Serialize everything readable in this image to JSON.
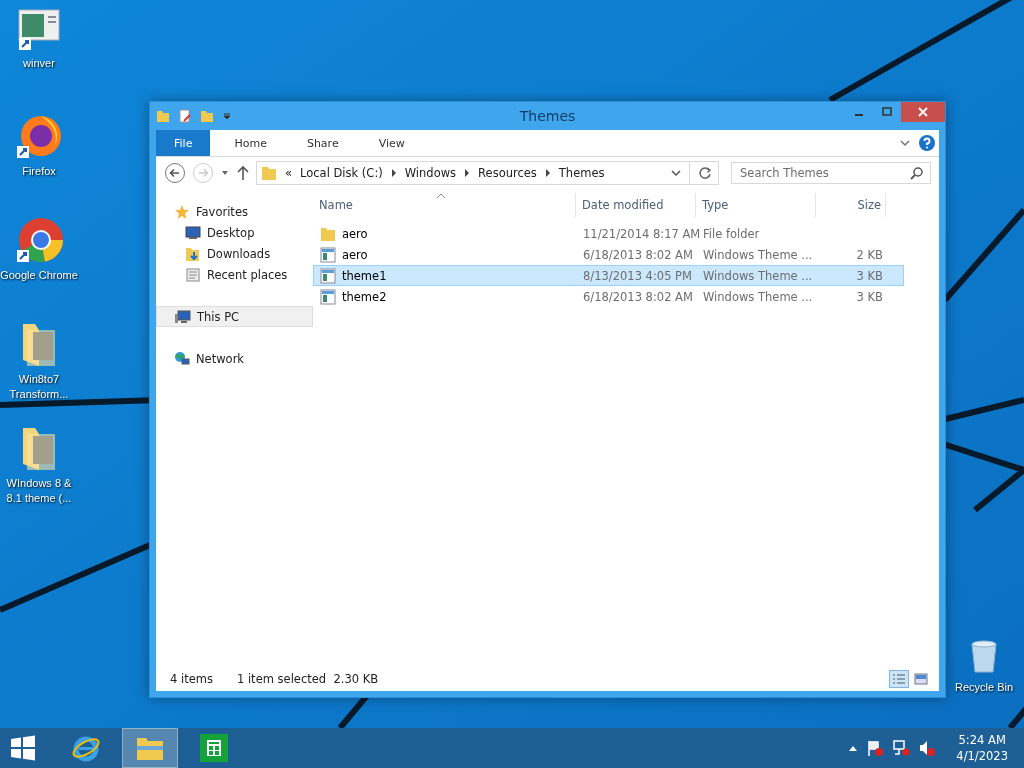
{
  "desktop_icons": [
    {
      "label": "winver",
      "kind": "window"
    },
    {
      "label": "Firefox",
      "kind": "firefox"
    },
    {
      "label": "Google Chrome",
      "kind": "chrome"
    },
    {
      "label": "Win8to7 Transform...",
      "kind": "folder"
    },
    {
      "label": "WIndows 8 & 8.1 theme (...",
      "kind": "folder"
    }
  ],
  "recycle_bin": {
    "label": "Recycle Bin"
  },
  "window": {
    "title": "Themes",
    "ribbon_tabs": [
      {
        "label": "File",
        "selected": true
      },
      {
        "label": "Home",
        "selected": false
      },
      {
        "label": "Share",
        "selected": false
      },
      {
        "label": "View",
        "selected": false
      }
    ],
    "address": {
      "overflow": "«",
      "crumbs": [
        "Local Disk (C:)",
        "Windows",
        "Resources",
        "Themes"
      ]
    },
    "search": {
      "placeholder": "Search Themes"
    },
    "nav": [
      {
        "label": "Favorites",
        "kind": "star",
        "selected": false,
        "children": [
          {
            "label": "Desktop",
            "kind": "desktop",
            "selected": false
          },
          {
            "label": "Downloads",
            "kind": "downloads",
            "selected": false
          },
          {
            "label": "Recent places",
            "kind": "recent",
            "selected": false
          }
        ]
      },
      {
        "label": "This PC",
        "kind": "pc",
        "selected": true
      },
      {
        "label": "Network",
        "kind": "network",
        "selected": false
      }
    ],
    "columns": [
      "Name",
      "Date modified",
      "Type",
      "Size"
    ],
    "files": [
      {
        "name": "aero",
        "kind": "folder",
        "date": "11/21/2014 8:17 AM",
        "type": "File folder",
        "selected": false
      },
      {
        "name": "aero",
        "kind": "theme",
        "date": "6/18/2013 8:02 AM",
        "type": "Windows Theme ...",
        "size": "2 KB",
        "selected": false
      },
      {
        "name": "theme1",
        "kind": "theme",
        "date": "8/13/2013 4:05 PM",
        "type": "Windows Theme ...",
        "size": "3 KB",
        "selected": true
      },
      {
        "name": "theme2",
        "kind": "theme",
        "date": "6/18/2013 8:02 AM",
        "type": "Windows Theme ...",
        "size": "3 KB",
        "selected": false
      }
    ],
    "status": {
      "count": "4 items",
      "selection": "1 item selected  2.30 KB"
    }
  },
  "taskbar": {
    "apps": [
      {
        "kind": "ie",
        "active": false
      },
      {
        "kind": "explorer",
        "active": true
      },
      {
        "kind": "store",
        "active": false
      }
    ],
    "clock": {
      "time": "5:24 AM",
      "date": "4/1/2023"
    }
  }
}
